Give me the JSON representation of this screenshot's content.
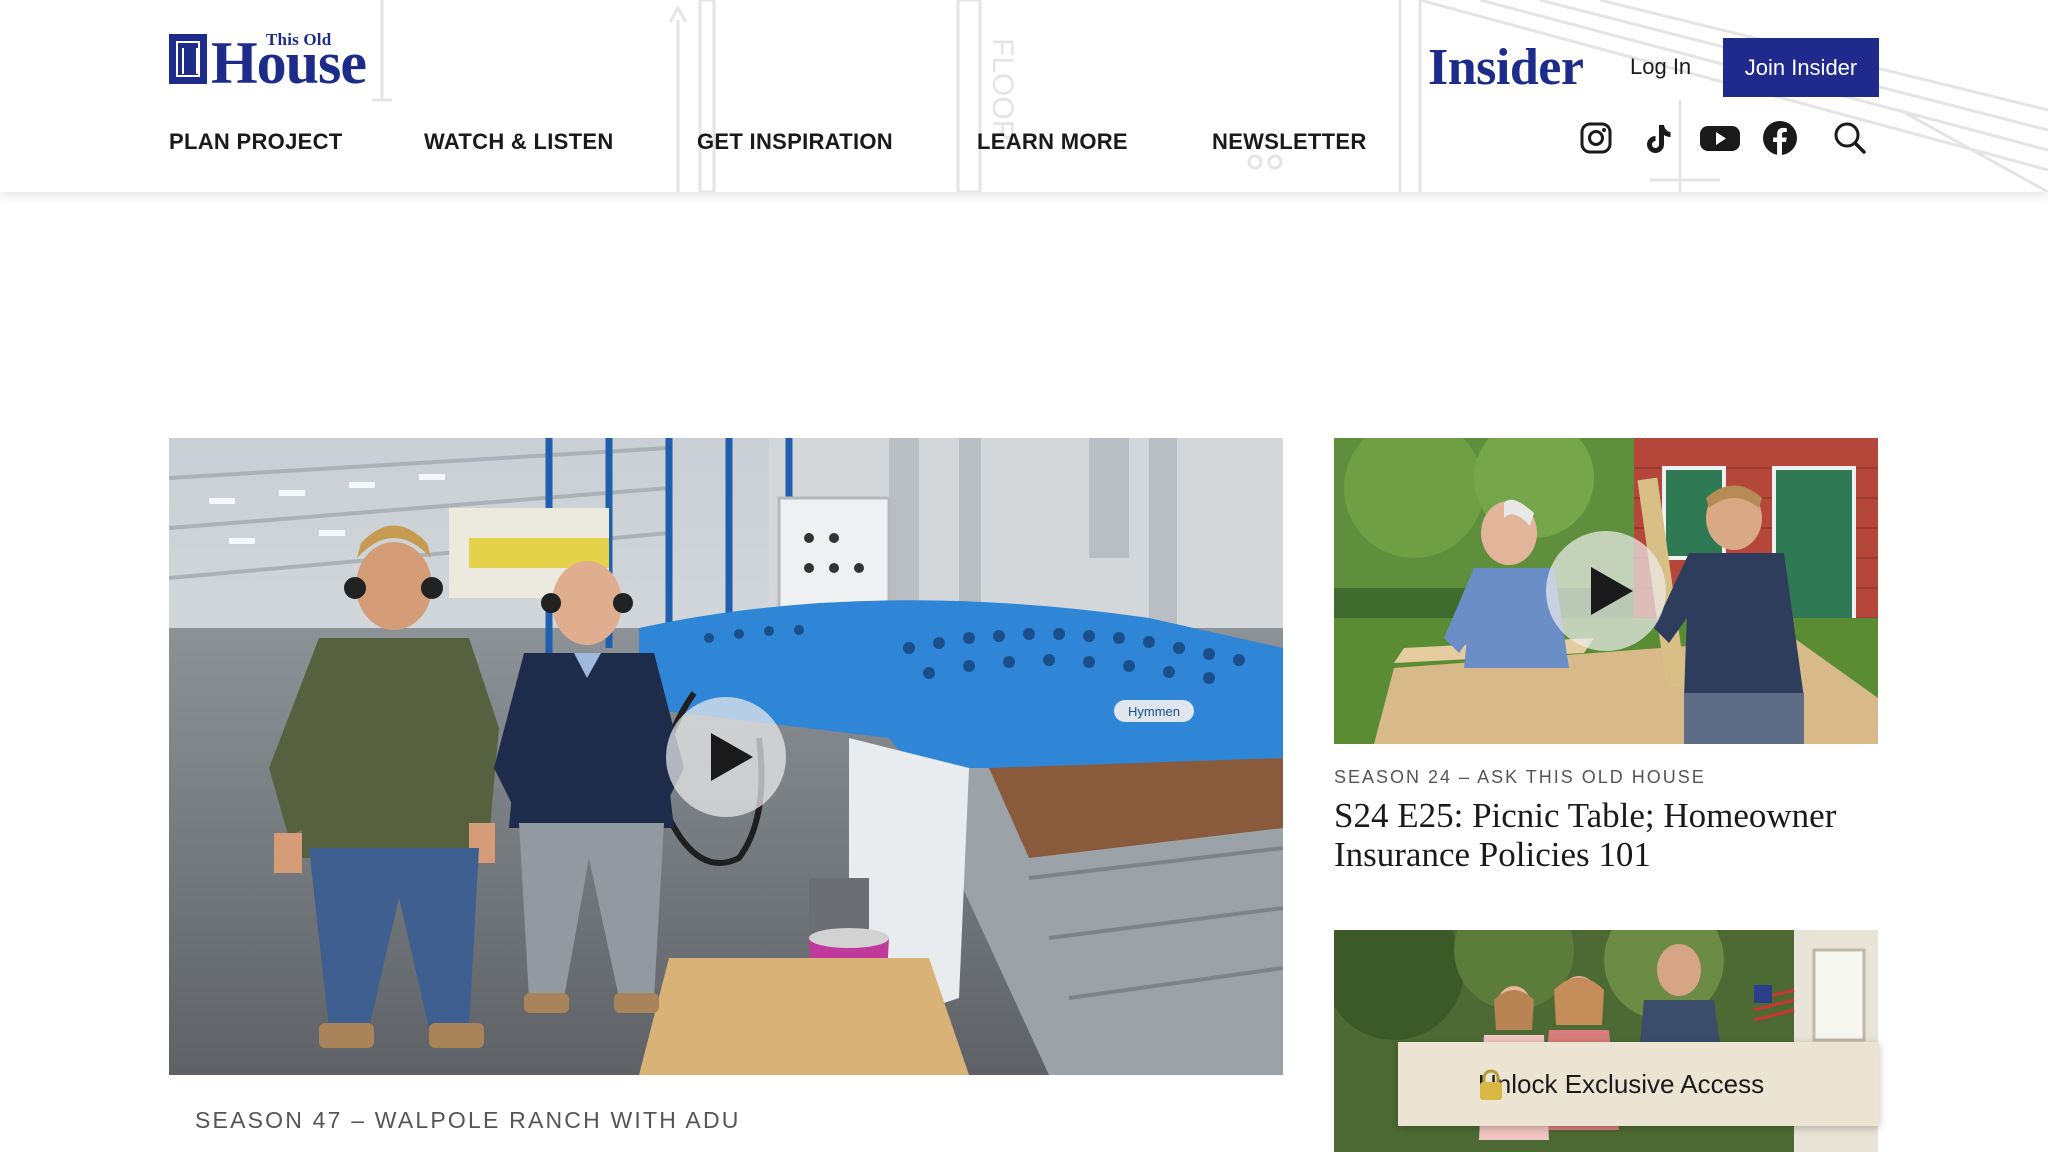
{
  "header": {
    "logo": {
      "small_text": "This Old",
      "big_text": "House"
    },
    "insider_logo": "Insider",
    "login_label": "Log In",
    "join_label": "Join Insider",
    "nav": [
      {
        "label": "PLAN PROJECT"
      },
      {
        "label": "WATCH & LISTEN"
      },
      {
        "label": "GET INSPIRATION"
      },
      {
        "label": "LEARN MORE"
      },
      {
        "label": "NEWSLETTER"
      }
    ],
    "social_icons": [
      "instagram-icon",
      "tiktok-icon",
      "youtube-icon",
      "facebook-icon",
      "search-icon"
    ],
    "blueprint_text": "FLOOR"
  },
  "main": {
    "hero": {
      "kicker": "SEASON 47 – WALPOLE RANCH WITH ADU",
      "machine_label": "Hymmen"
    },
    "cards": [
      {
        "kicker": "SEASON 24 – ASK THIS OLD HOUSE",
        "title": "S24 E25: Picnic Table; Homeowner Insurance Policies 101"
      }
    ],
    "unlock_label": "Unlock Exclusive Access"
  },
  "colors": {
    "brand_navy": "#1d2c8a",
    "join_button": "#1f2a8c",
    "unlock_bg": "#ebe4d2",
    "machine_blue": "#2f86d6"
  }
}
